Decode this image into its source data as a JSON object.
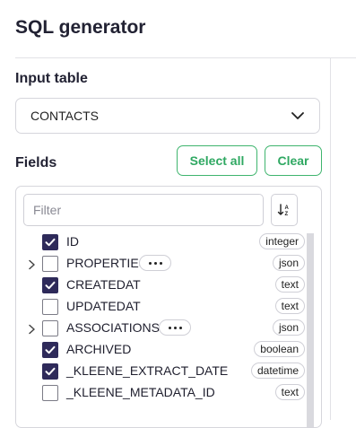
{
  "page": {
    "title": "SQL generator"
  },
  "input_table": {
    "label": "Input table",
    "selected": "CONTACTS"
  },
  "fields": {
    "label": "Fields",
    "select_all_label": "Select all",
    "clear_label": "Clear",
    "filter_placeholder": "Filter",
    "items": [
      {
        "name": "ID",
        "type": "integer",
        "checked": true,
        "expandable": false,
        "has_menu": false
      },
      {
        "name": "PROPERTIES",
        "type": "json",
        "checked": false,
        "expandable": true,
        "has_menu": true
      },
      {
        "name": "CREATEDAT",
        "type": "text",
        "checked": true,
        "expandable": false,
        "has_menu": false
      },
      {
        "name": "UPDATEDAT",
        "type": "text",
        "checked": false,
        "expandable": false,
        "has_menu": false
      },
      {
        "name": "ASSOCIATIONS",
        "type": "json",
        "checked": false,
        "expandable": true,
        "has_menu": true
      },
      {
        "name": "ARCHIVED",
        "type": "boolean",
        "checked": true,
        "expandable": false,
        "has_menu": false
      },
      {
        "name": "_KLEENE_EXTRACT_DATE",
        "type": "datetime",
        "checked": true,
        "expandable": false,
        "has_menu": false
      },
      {
        "name": "_KLEENE_METADATA_ID",
        "type": "text",
        "checked": false,
        "expandable": false,
        "has_menu": false
      }
    ]
  },
  "colors": {
    "accent": "#2fa862",
    "checkbox_fill": "#2e2a5a"
  }
}
